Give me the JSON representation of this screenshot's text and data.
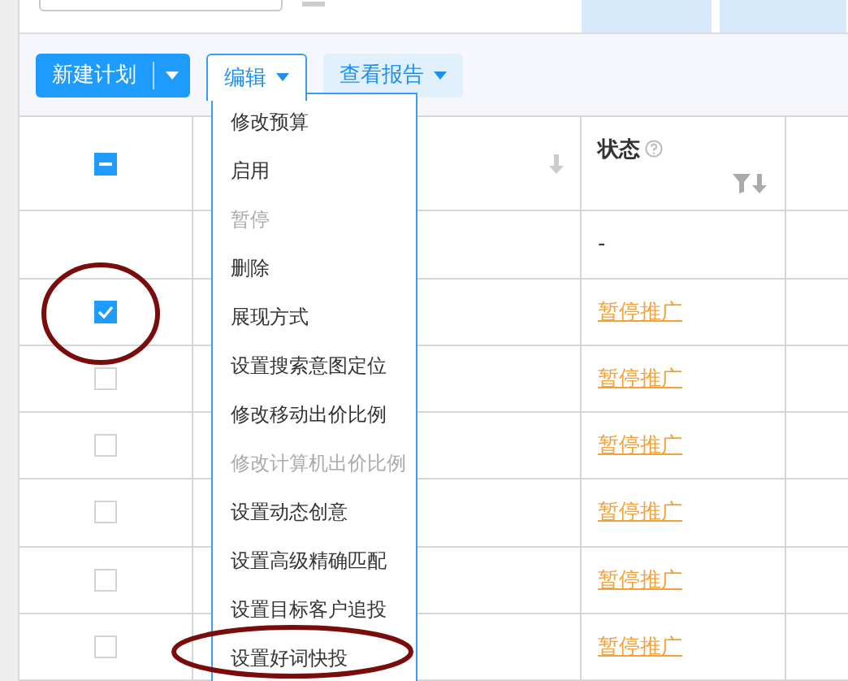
{
  "toolbar": {
    "new_button": "新建计划",
    "edit_button": "编辑",
    "report_button": "查看报告"
  },
  "table": {
    "header": {
      "select_all_mixed": true,
      "status": "状态"
    },
    "rows": [
      {
        "kind": "summary",
        "status": "-"
      },
      {
        "kind": "item",
        "checked": true,
        "status": "暂停推广"
      },
      {
        "kind": "item",
        "checked": false,
        "status": "暂停推广"
      },
      {
        "kind": "item",
        "checked": false,
        "status": "暂停推广"
      },
      {
        "kind": "item",
        "checked": false,
        "status": "暂停推广"
      },
      {
        "kind": "item",
        "checked": false,
        "status": "暂停推广"
      },
      {
        "kind": "item",
        "checked": false,
        "status": "暂停推广"
      }
    ]
  },
  "edit_menu": [
    {
      "label": "修改预算",
      "disabled": false
    },
    {
      "label": "启用",
      "disabled": false
    },
    {
      "label": "暂停",
      "disabled": true
    },
    {
      "label": "删除",
      "disabled": false
    },
    {
      "label": "展现方式",
      "disabled": false
    },
    {
      "label": "设置搜索意图定位",
      "disabled": false
    },
    {
      "label": "修改移动出价比例",
      "disabled": false
    },
    {
      "label": "修改计算机出价比例",
      "disabled": true
    },
    {
      "label": "设置动态创意",
      "disabled": false
    },
    {
      "label": "设置高级精确匹配",
      "disabled": false
    },
    {
      "label": "设置目标客户追投",
      "disabled": false
    },
    {
      "label": "设置好词快投",
      "disabled": false
    }
  ]
}
